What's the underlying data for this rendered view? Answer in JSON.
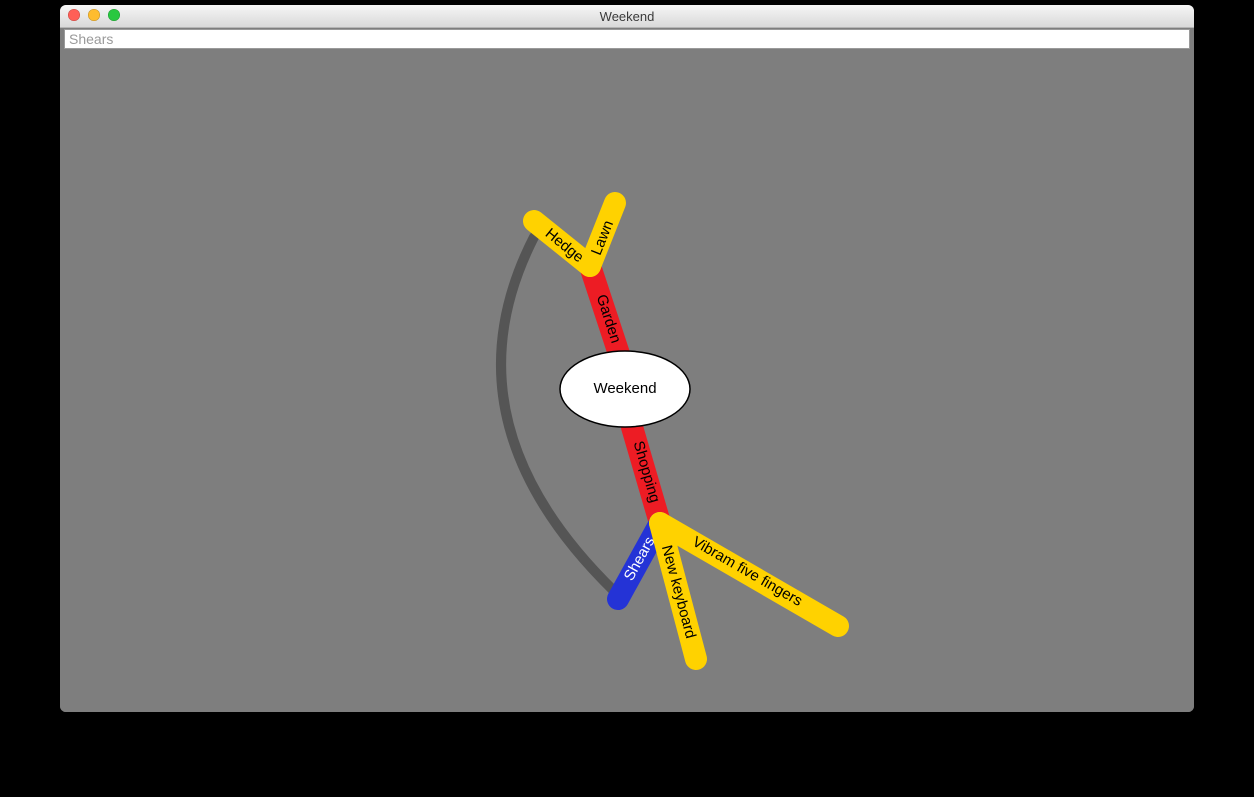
{
  "window": {
    "title": "Weekend"
  },
  "search": {
    "value": "Shears"
  },
  "mindmap": {
    "root": "Weekend",
    "colors": {
      "red": "#ed1c24",
      "yellow": "#ffd200",
      "blue": "#2433d6",
      "dark": "#555555"
    },
    "branches": {
      "garden": {
        "label": "Garden",
        "color": "red",
        "text_color": "#000"
      },
      "hedge": {
        "label": "Hedge",
        "color": "yellow",
        "text_color": "#000"
      },
      "lawn": {
        "label": "Lawn",
        "color": "yellow",
        "text_color": "#000"
      },
      "shopping": {
        "label": "Shopping",
        "color": "red",
        "text_color": "#000"
      },
      "shears": {
        "label": "Shears",
        "color": "blue",
        "text_color": "#fff"
      },
      "newkeyboard": {
        "label": "New keyboard",
        "color": "yellow",
        "text_color": "#000"
      },
      "vibram": {
        "label": "Vibram five fingers",
        "color": "yellow",
        "text_color": "#000"
      }
    }
  }
}
